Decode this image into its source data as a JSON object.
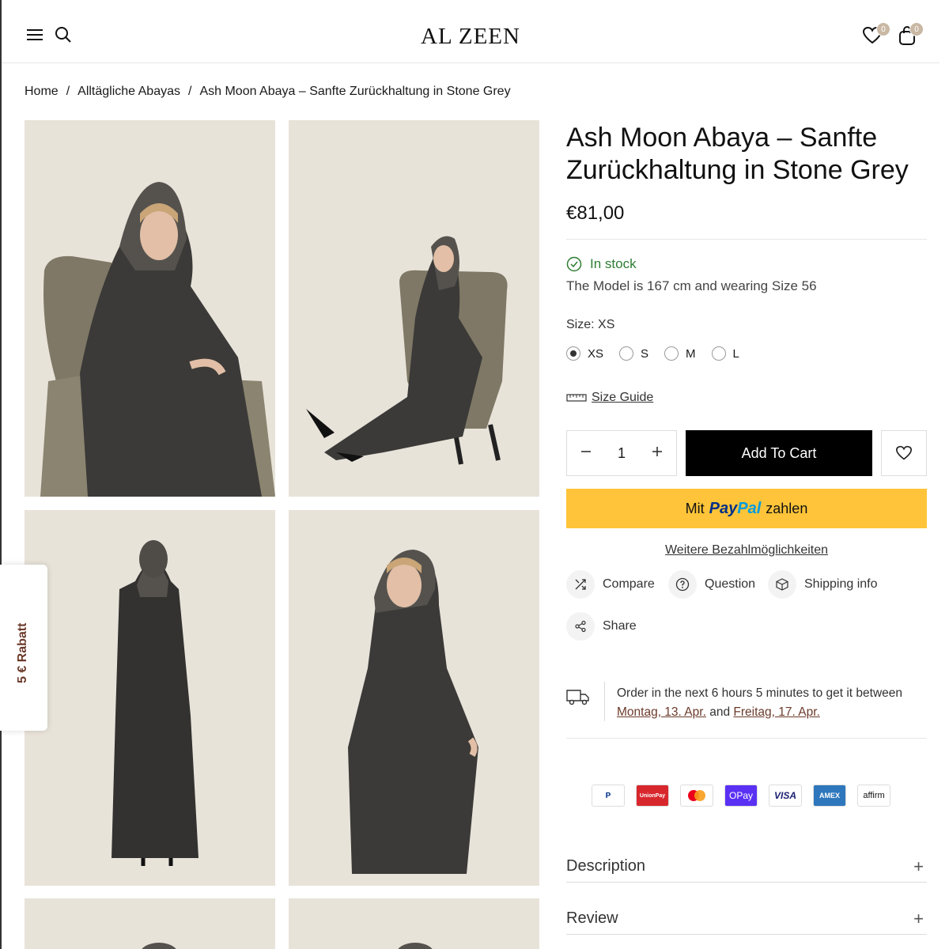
{
  "header": {
    "logo": "AL ZEEN",
    "wishlist_count": "0",
    "cart_count": "0"
  },
  "breadcrumb": {
    "items": [
      "Home",
      "Alltägliche Abayas",
      "Ash Moon Abaya – Sanfte Zurückhaltung in Stone Grey"
    ],
    "separator": "/"
  },
  "side_tab": {
    "label": "5 € Rabatt"
  },
  "product": {
    "title": "Ash Moon Abaya – Sanfte Zurückhaltung in Stone Grey",
    "price": "€81,00",
    "stock": "In stock",
    "model_note": "The Model is 167 cm and wearing Size 56",
    "size_label": "Size:",
    "size_selected": "XS",
    "sizes": [
      "XS",
      "S",
      "M",
      "L"
    ],
    "size_guide": "Size Guide",
    "quantity": "1",
    "add_to_cart": "Add To Cart",
    "paypal_prefix": "Mit",
    "paypal_brand_1": "Pay",
    "paypal_brand_2": "Pal",
    "paypal_suffix": "zahlen",
    "more_payment": "Weitere Bezahlmöglichkeiten"
  },
  "actions": {
    "compare": "Compare",
    "question": "Question",
    "shipping": "Shipping info",
    "share": "Share"
  },
  "delivery": {
    "text_1": "Order in the next 6 hours 5 minutes to get it between",
    "date_from": "Montag, 13. Apr.",
    "and": "and",
    "date_to": "Freitag, 17. Apr."
  },
  "payment_icons": [
    "paypal-icon",
    "unionpay-icon",
    "mastercard-icon",
    "opay-icon",
    "visa-icon",
    "amex-icon",
    "affirm-icon"
  ],
  "payment_labels": {
    "paypal": "P",
    "unionpay": "UnionPay",
    "opay": "OPay",
    "visa": "VISA",
    "amex": "AMEX",
    "affirm": "affirm"
  },
  "accordion": {
    "description": "Description",
    "review": "Review"
  },
  "colors": {
    "accent_brown": "#6b3a2a",
    "paypal_yellow": "#ffc439",
    "stock_green": "#2e7d32",
    "photo_bg": "#e7e2d8",
    "garment": "#3b3a38"
  }
}
